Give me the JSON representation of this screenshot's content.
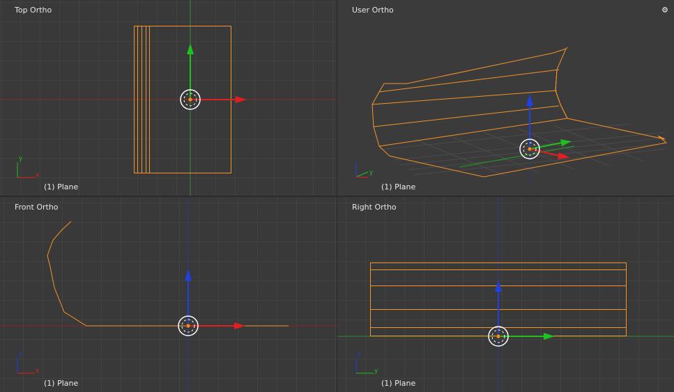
{
  "viewports": {
    "top": {
      "label": "Top Ortho",
      "object": "(1) Plane"
    },
    "user": {
      "label": "User Ortho",
      "object": "(1) Plane"
    },
    "front": {
      "label": "Front Ortho",
      "object": "(1) Plane"
    },
    "right": {
      "label": "Right Ortho",
      "object": "(1) Plane"
    }
  },
  "axis_letters": {
    "x": "x",
    "y": "y",
    "z": "z"
  },
  "colors": {
    "selection_outline": "#f5942a",
    "axis_x": "#e02020",
    "axis_y": "#20c020",
    "axis_z": "#2040e0",
    "origin": "#f08a24"
  },
  "icons": {
    "corner_widget": "gear-icon"
  }
}
